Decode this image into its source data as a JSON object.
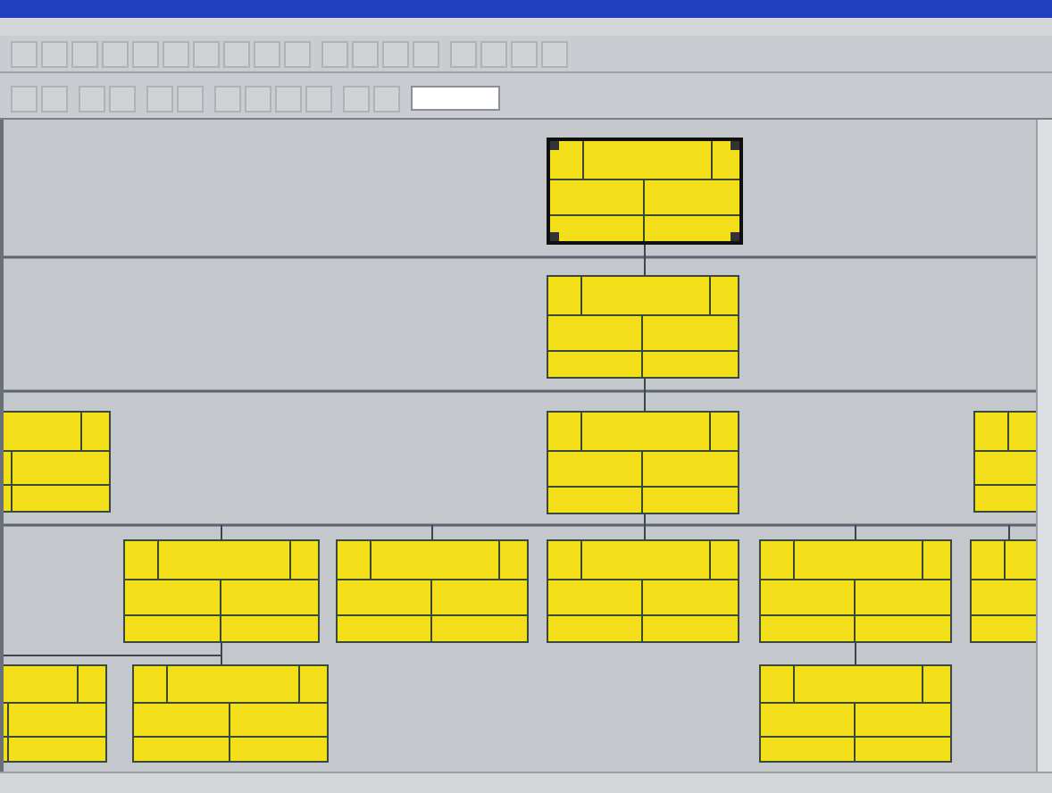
{
  "chart": {
    "nodes": [
      {
        "selected": true
      },
      {
        "selected": false
      },
      {
        "selected": false
      },
      {
        "selected": false
      },
      {
        "selected": false
      },
      {
        "selected": false
      },
      {
        "selected": false
      },
      {
        "selected": false
      },
      {
        "selected": false
      },
      {
        "selected": false
      },
      {
        "selected": false
      },
      {
        "selected": false
      },
      {
        "selected": false
      }
    ]
  }
}
